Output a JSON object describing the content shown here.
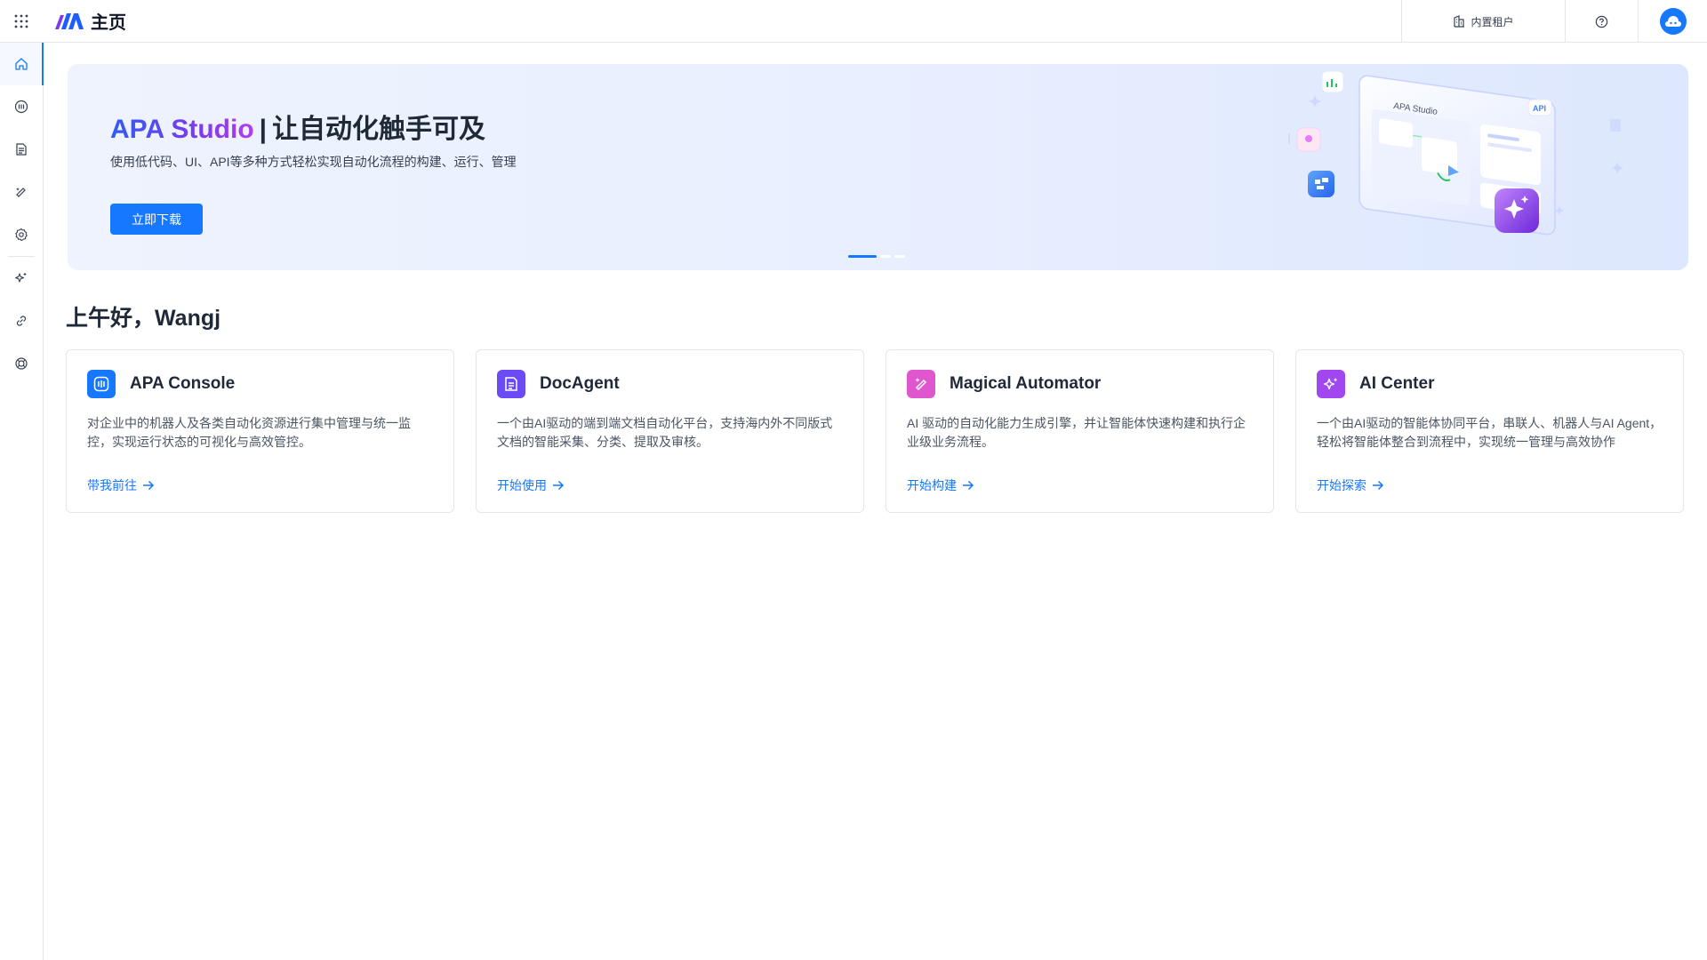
{
  "header": {
    "title": "主页",
    "tenant_label": "内置租户"
  },
  "rail": {
    "items": [
      {
        "icon": "home-icon",
        "active": true
      },
      {
        "icon": "console-icon"
      },
      {
        "icon": "document-icon"
      },
      {
        "icon": "wand-icon"
      },
      {
        "icon": "settings-icon"
      },
      {
        "icon": "sparkle-icon"
      },
      {
        "icon": "link-icon"
      },
      {
        "icon": "support-icon"
      }
    ]
  },
  "banner": {
    "title_brand": "APA Studio",
    "title_sep": "|",
    "title_rest": "让自动化触手可及",
    "subtitle": "使用低代码、UI、API等多种方式轻松实现自动化流程的构建、运行、管理",
    "button_label": "立即下载",
    "illus_window_title": "APA Studio",
    "illus_badge": "API"
  },
  "greeting": "上午好，Wangj",
  "cards": [
    {
      "title": "APA Console",
      "desc": "对企业中的机器人及各类自动化资源进行集中管理与统一监控，实现运行状态的可视化与高效管控。",
      "link": "带我前往",
      "icon": "console-icon",
      "color": "#1677ff"
    },
    {
      "title": "DocAgent",
      "desc": "一个由AI驱动的端到端文档自动化平台，支持海内外不同版式文档的智能采集、分类、提取及审核。",
      "link": "开始使用",
      "icon": "document-icon",
      "color": "#6a4bf5"
    },
    {
      "title": "Magical Automator",
      "desc": "AI 驱动的自动化能力生成引擎，并让智能体快速构建和执行企业级业务流程。",
      "link": "开始构建",
      "icon": "wand-icon",
      "color": "#e056cf"
    },
    {
      "title": "AI Center",
      "desc": "一个由AI驱动的智能体协同平台，串联人、机器人与AI Agent，轻松将智能体整合到流程中，实现统一管理与高效协作",
      "link": "开始探索",
      "icon": "sparkle-icon",
      "color": "#a147f0"
    }
  ],
  "colors": {
    "accent": "#1677ff",
    "banner_bg": "#e8efff"
  }
}
